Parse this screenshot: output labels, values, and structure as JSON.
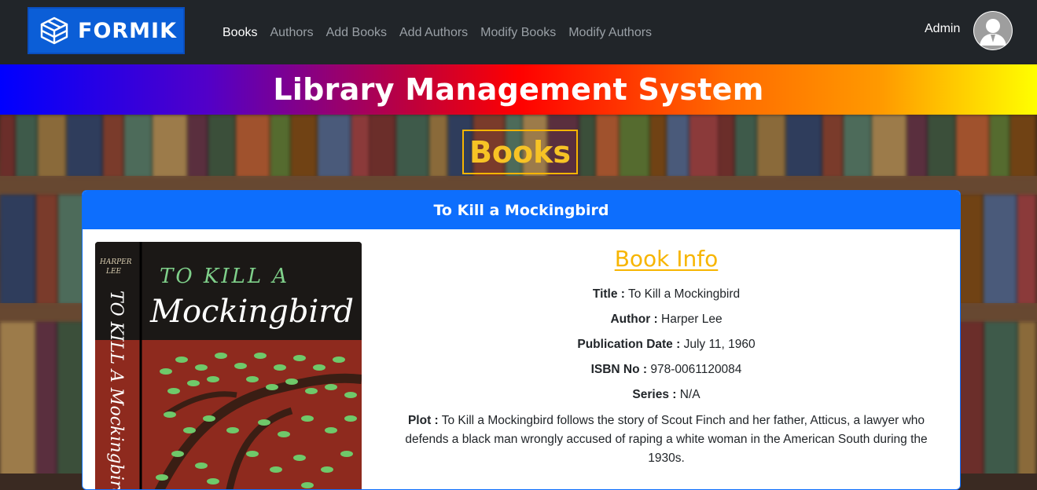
{
  "navbar": {
    "brand": "FORMIK",
    "links": [
      {
        "label": "Books",
        "active": true
      },
      {
        "label": "Authors",
        "active": false
      },
      {
        "label": "Add Books",
        "active": false
      },
      {
        "label": "Add Authors",
        "active": false
      },
      {
        "label": "Modify Books",
        "active": false
      },
      {
        "label": "Modify Authors",
        "active": false
      }
    ],
    "user_name": "Admin"
  },
  "banner": {
    "title": "Library Management System"
  },
  "section": {
    "title": "Books"
  },
  "card": {
    "header": "To Kill a Mockingbird",
    "cover": {
      "author_line1": "HARPER",
      "author_line2": "LEE",
      "title_top": "TO KILL A",
      "title_script": "Mockingbird",
      "spine_text": "TO KILL A Mockingbird"
    },
    "info_title": "Book Info",
    "fields": {
      "title_label": "Title :",
      "title_value": "To Kill a Mockingbird",
      "author_label": "Author :",
      "author_value": "Harper Lee",
      "pubdate_label": "Publication Date :",
      "pubdate_value": "July 11, 1960",
      "isbn_label": "ISBN No :",
      "isbn_value": "978-0061120084",
      "series_label": "Series :",
      "series_value": "N/A",
      "plot_label": "Plot :",
      "plot_value": "To Kill a Mockingbird follows the story of Scout Finch and her father, Atticus, a lawyer who defends a black man wrongly accused of raping a white woman in the American South during the 1930s."
    }
  },
  "colors": {
    "navbar_bg": "#212529",
    "brand_bg": "#0b5ed7",
    "card_header": "#0d6efd",
    "accent_gold": "#f7b500"
  }
}
